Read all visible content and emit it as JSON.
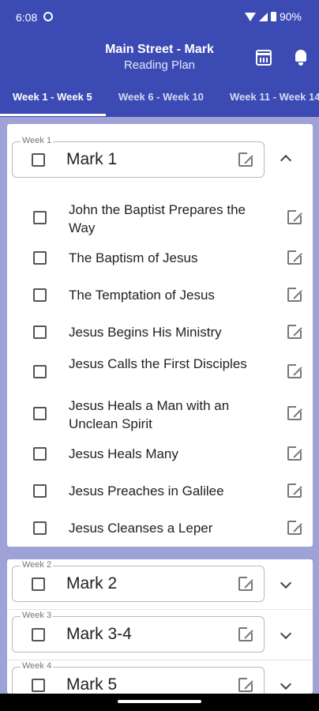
{
  "status": {
    "time": "6:08",
    "battery": "90%"
  },
  "header": {
    "title": "Main Street - Mark",
    "subtitle": "Reading Plan"
  },
  "tabs": [
    {
      "label": "Week 1 - Week 5"
    },
    {
      "label": "Week 6 - Week 10"
    },
    {
      "label": "Week 11 - Week 14"
    }
  ],
  "weeks": [
    {
      "label": "Week 1",
      "title": "Mark 1",
      "items": [
        "John the Baptist Prepares the Way",
        "The Baptism of Jesus",
        "The Temptation of Jesus",
        "Jesus Begins His Ministry",
        "Jesus Calls the First Disciples",
        "Jesus Heals a Man with an Unclean Spirit",
        "Jesus Heals Many",
        "Jesus Preaches in Galilee",
        "Jesus Cleanses a Leper"
      ]
    },
    {
      "label": "Week 2",
      "title": "Mark 2"
    },
    {
      "label": "Week 3",
      "title": "Mark 3-4"
    },
    {
      "label": "Week 4",
      "title": "Mark 5"
    }
  ]
}
